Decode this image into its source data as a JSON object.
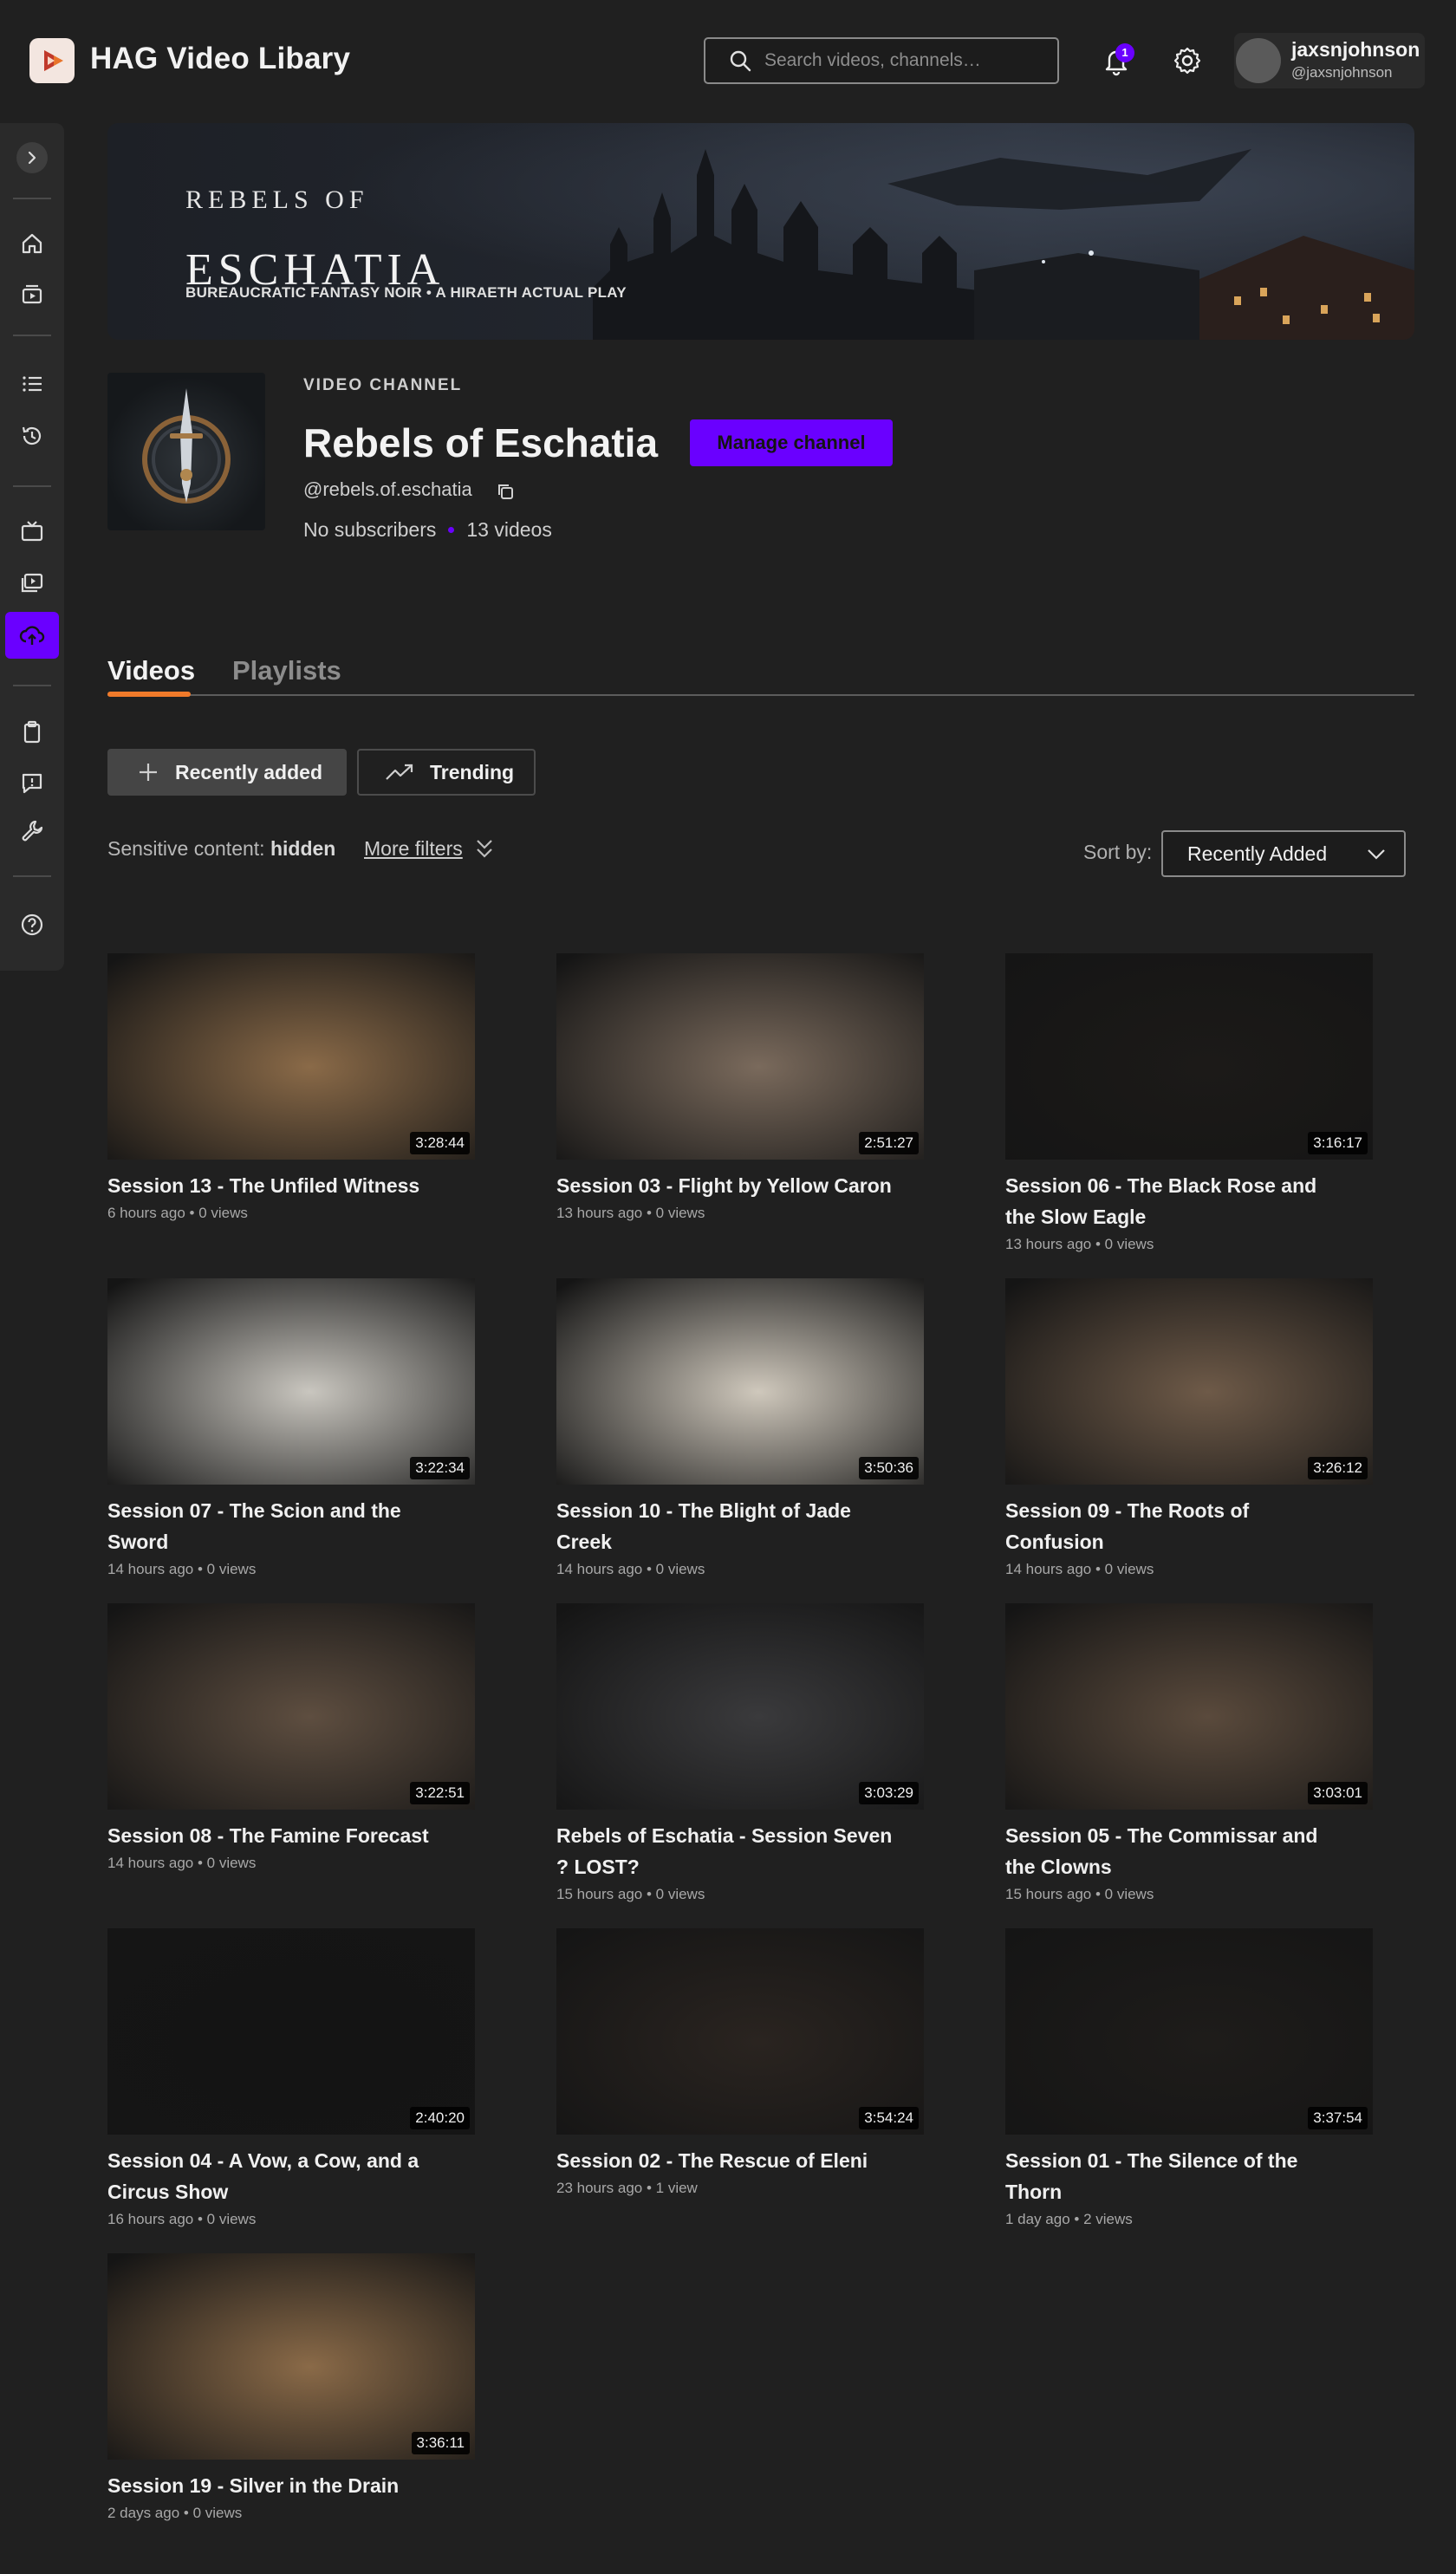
{
  "app": {
    "title": "HAG Video Libary"
  },
  "search": {
    "placeholder": "Search videos, channels…"
  },
  "notifications": {
    "count": "1"
  },
  "user": {
    "name": "jaxsnjohnson",
    "handle": "@jaxsnjohnson"
  },
  "banner": {
    "over_title": "REBELS OF",
    "title": "ESCHATIA",
    "subtitle": "BUREAUCRATIC FANTASY NOIR • A HIRAETH ACTUAL PLAY"
  },
  "channel": {
    "kind": "VIDEO CHANNEL",
    "name": "Rebels of Eschatia",
    "handle": "@rebels.of.eschatia",
    "subscribers": "No subscribers",
    "video_count": "13 videos",
    "manage_label": "Manage channel"
  },
  "tabs": [
    {
      "label": "Videos",
      "active": true
    },
    {
      "label": "Playlists",
      "active": false
    }
  ],
  "filters": {
    "recent_label": "Recently added",
    "trending_label": "Trending",
    "sensitive_label": "Sensitive content:",
    "sensitive_value": "hidden",
    "more_filters": "More filters",
    "sort_label": "Sort by:",
    "sort_value": "Recently Added"
  },
  "colors": {
    "accent": "#6a00ff",
    "tab_underline": "#f07a2a",
    "background": "#202020"
  },
  "videos": [
    {
      "title": "Session 13 - The Unfiled Witness",
      "meta": "6 hours ago • 0 views",
      "duration": "3:28:44",
      "tone": "#8a6a48"
    },
    {
      "title": "Session 03 - Flight by Yellow Caron",
      "meta": "13 hours ago • 0 views",
      "duration": "2:51:27",
      "tone": "#7a6a5c"
    },
    {
      "title": "Session 06 - The Black Rose and the Slow Eagle",
      "meta": "13 hours ago • 0 views",
      "duration": "3:16:17",
      "tone": "#1c1a18"
    },
    {
      "title": "Session 07 - The Scion and the Sword",
      "meta": "14 hours ago • 0 views",
      "duration": "3:22:34",
      "tone": "#c9c6bf"
    },
    {
      "title": "Session 10 - The Blight of Jade Creek",
      "meta": "14 hours ago • 0 views",
      "duration": "3:50:36",
      "tone": "#cfc8bc"
    },
    {
      "title": "Session 09 - The Roots of Confusion",
      "meta": "14 hours ago • 0 views",
      "duration": "3:26:12",
      "tone": "#6e5a48"
    },
    {
      "title": "Session 08 - The Famine Forecast",
      "meta": "14 hours ago • 0 views",
      "duration": "3:22:51",
      "tone": "#5e4e40"
    },
    {
      "title": "Rebels of Eschatia - Session Seven ? LOST?",
      "meta": "15 hours ago • 0 views",
      "duration": "3:03:29",
      "tone": "#3a3a3c"
    },
    {
      "title": "Session 05 - The Commissar and the Clowns",
      "meta": "15 hours ago • 0 views",
      "duration": "3:03:01",
      "tone": "#5a4a3c"
    },
    {
      "title": "Session 04 - A Vow, a Cow, and a Circus Show",
      "meta": "16 hours ago • 0 views",
      "duration": "2:40:20",
      "tone": "#141414"
    },
    {
      "title": "Session 02 - The Rescue of Eleni",
      "meta": "23 hours ago • 1 view",
      "duration": "3:54:24",
      "tone": "#2a2420"
    },
    {
      "title": "Session 01 - The Silence of the Thorn",
      "meta": "1 day ago • 2 views",
      "duration": "3:37:54",
      "tone": "#1e1c1a"
    },
    {
      "title": "Session 19 - Silver in the Drain",
      "meta": "2 days ago • 0 views",
      "duration": "3:36:11",
      "tone": "#8a6a48"
    }
  ]
}
